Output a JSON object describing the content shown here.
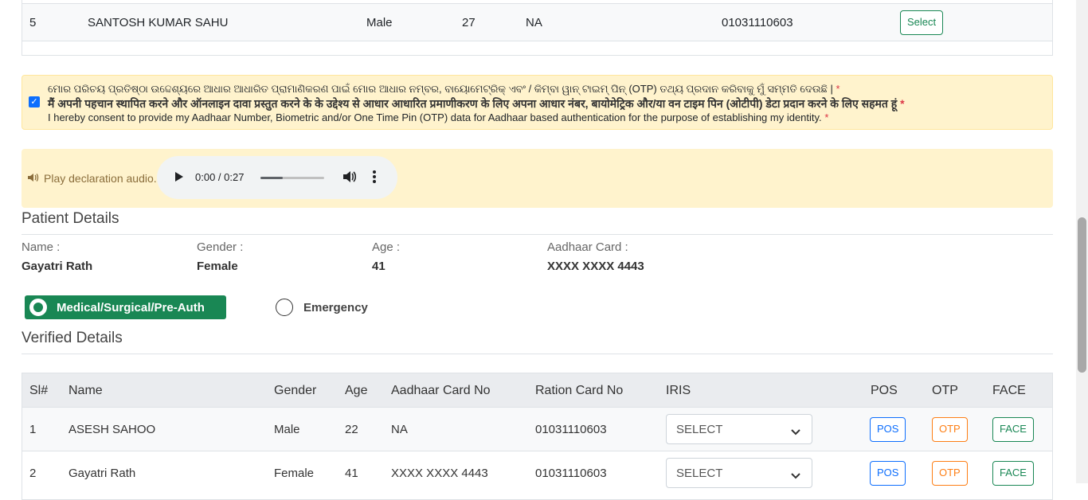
{
  "top_table": {
    "row": {
      "sl": "5",
      "name": "SANTOSH KUMAR SAHU",
      "gender": "Male",
      "age": "27",
      "aadhaar": "NA",
      "ration": "01031110603",
      "action": "Select"
    }
  },
  "consent": {
    "odia": "ମୋର ପରିଚୟ ପ୍ରତିଷ୍ଠା ଉଦ୍ଦେଶ୍ୟରେ ଆଧାର ଆଧାରିତ ପ୍ରାମାଣିକରଣ ପାଇଁ ମୋର ଆଧାର ନମ୍ବର, ବାୟୋମେଟ୍ରିକ୍ ଏବଂ / କିମ୍ବା ୱାନ୍ ଟାଇମ୍ ପିନ୍ (OTP) ତଥ୍ୟ ପ୍ରଦାନ କରିବାକୁ ମୁଁ ସମ୍ମତି ଦେଉଛି |",
    "hindi": "मैं अपनी पहचान स्थापित करने और ऑनलाइन दावा प्रस्तुत करने के के उद्देश्य से आधार आधारित प्रमाणीकरण के लिए अपना आधार नंबर, बायोमेट्रिक और/या वन टाइम पिन (ओटीपी) डेटा प्रदान करने के लिए सहमत हूं",
    "english": "I hereby consent to provide my Aadhaar Number, Biometric and/or One Time Pin (OTP) data for Aadhaar based authentication for the purpose of establishing my identity.",
    "required_mark": "*",
    "checked": true
  },
  "audio": {
    "label": "Play declaration audio.",
    "time": "0:00 / 0:27",
    "progress": 0.35
  },
  "patient": {
    "title": "Patient Details",
    "name_label": "Name :",
    "name": "Gayatri Rath",
    "gender_label": "Gender :",
    "gender": "Female",
    "age_label": "Age :",
    "age": "41",
    "aadhaar_label": "Aadhaar Card :",
    "aadhaar": "XXXX XXXX 4443"
  },
  "case_type": {
    "option1": "Medical/Surgical/Pre-Auth",
    "option2": "Emergency",
    "selected": "Medical/Surgical/Pre-Auth"
  },
  "verified": {
    "title": "Verified Details",
    "headers": [
      "Sl#",
      "Name",
      "Gender",
      "Age",
      "Aadhaar Card No",
      "Ration Card No",
      "IRIS",
      "POS",
      "OTP",
      "FACE"
    ],
    "rows": [
      {
        "sl": "1",
        "name": "ASESH SAHOO",
        "gender": "Male",
        "age": "22",
        "aadhaar": "NA",
        "ration": "01031110603",
        "iris": "SELECT",
        "pos": "POS",
        "otp": "OTP",
        "face": "FACE"
      },
      {
        "sl": "2",
        "name": "Gayatri Rath",
        "gender": "Female",
        "age": "41",
        "aadhaar": "XXXX XXXX 4443",
        "ration": "01031110603",
        "iris": "SELECT",
        "pos": "POS",
        "otp": "OTP",
        "face": "FACE"
      }
    ]
  },
  "colors": {
    "success": "#198754",
    "primary": "#0d6efd",
    "warning_bg": "#fff3cd",
    "orange": "#fd7e14",
    "danger": "#dc3545"
  }
}
